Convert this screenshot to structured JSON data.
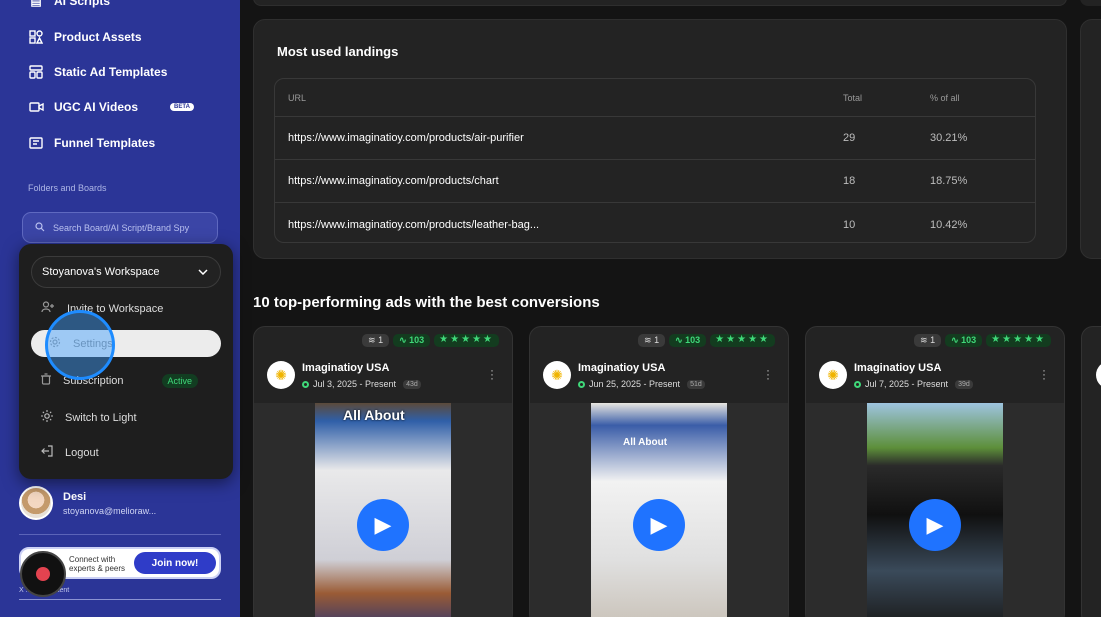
{
  "sidebar": {
    "partial_item": "AI Scripts",
    "items": [
      {
        "label": "Product Assets",
        "icon": "assets-icon"
      },
      {
        "label": "Static Ad Templates",
        "icon": "template-icon"
      },
      {
        "label": "UGC AI Videos",
        "icon": "video-icon",
        "badge": "BETA"
      },
      {
        "label": "Funnel Templates",
        "icon": "funnel-icon"
      }
    ],
    "section_label": "Folders and Boards",
    "search_placeholder": "Search Board/AI Script/Brand Spy",
    "user": {
      "name": "Desi",
      "email": "stoyanova@melioraw..."
    },
    "join": {
      "text_line1": "Connect with",
      "text_line2": "experts & peers",
      "button": "Join now!"
    },
    "hide_text": "X ... this content"
  },
  "menu": {
    "workspace": "Stoyanova's Workspace",
    "items": [
      {
        "label": "Invite to Workspace",
        "icon": "add-user-icon"
      },
      {
        "label": "Settings",
        "icon": "gear-icon"
      },
      {
        "label": "Subscription",
        "icon": "trash-icon",
        "badge": "Active"
      },
      {
        "label": "Switch to Light",
        "icon": "sun-icon"
      },
      {
        "label": "Logout",
        "icon": "logout-icon"
      }
    ]
  },
  "landings": {
    "title": "Most used landings",
    "columns": [
      "URL",
      "Total",
      "% of all"
    ],
    "rows": [
      [
        "https://www.imaginatioy.com/products/air-purifier",
        "29",
        "30.21%"
      ],
      [
        "https://www.imaginatioy.com/products/chart",
        "18",
        "18.75%"
      ],
      [
        "https://www.imaginatioy.com/products/leather-bag...",
        "10",
        "10.42%"
      ]
    ]
  },
  "ads": {
    "title": "10 top-performing ads with the best conversions",
    "cards": [
      {
        "count": "1",
        "score": "103",
        "stars": "★★★★★",
        "brand": "Imaginatioy USA",
        "date": "Jul 3, 2025 - Present",
        "days": "43d",
        "thumb_title": "All About"
      },
      {
        "count": "1",
        "score": "103",
        "stars": "★★★★★",
        "brand": "Imaginatioy USA",
        "date": "Jun 25, 2025 - Present",
        "days": "51d",
        "thumb_title": "All About"
      },
      {
        "count": "1",
        "score": "103",
        "stars": "★★★★★",
        "brand": "Imaginatioy USA",
        "date": "Jul 7, 2025 - Present",
        "days": "39d",
        "thumb_title": ""
      }
    ]
  },
  "colors": {
    "sidebar": "#2b3597",
    "accent_green": "#3fd879",
    "play_blue": "#1f73ff"
  }
}
